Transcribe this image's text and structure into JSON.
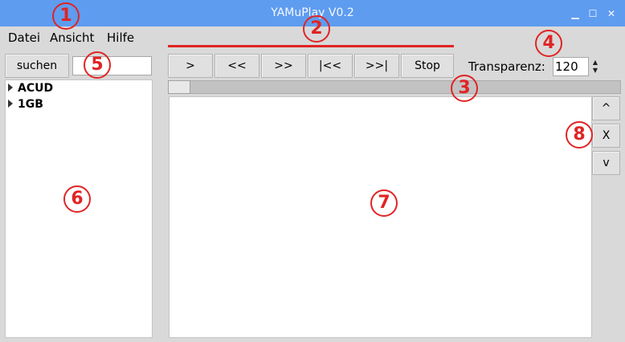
{
  "window": {
    "title": "YAMuPlay V0.2",
    "minimize_glyph": "▁",
    "maximize_glyph": "☐",
    "close_glyph": "✕"
  },
  "menu": {
    "items": [
      "Datei",
      "Ansicht",
      "Hilfe"
    ]
  },
  "search": {
    "button_label": "suchen",
    "value": ""
  },
  "transport": {
    "buttons": [
      ">",
      "<<",
      ">>",
      "|<<",
      ">>|",
      "Stop"
    ]
  },
  "transparency": {
    "label": "Transparenz:",
    "value": "120"
  },
  "position_slider": {
    "value_fraction": 0.0
  },
  "tree": {
    "items": [
      "ACUD",
      "1GB"
    ]
  },
  "side_buttons": [
    "^",
    "X",
    "v"
  ],
  "annotations": [
    "1",
    "2",
    "3",
    "4",
    "5",
    "6",
    "7",
    "8"
  ],
  "colors": {
    "titlebar": "#5e9cf0",
    "annotation": "#e02424"
  }
}
